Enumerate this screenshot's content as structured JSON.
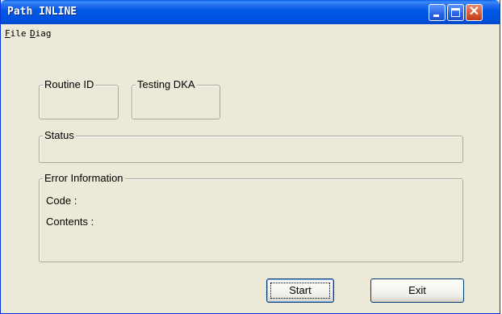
{
  "window": {
    "title": "Path INLINE",
    "controls": {
      "minimize": "minimize",
      "maximize": "maximize",
      "close": "close"
    }
  },
  "menu": {
    "items": [
      {
        "label_first": "F",
        "label_rest": "ile"
      },
      {
        "label_first": "D",
        "label_rest": "iag"
      }
    ]
  },
  "groups": {
    "routine_id": "Routine ID",
    "testing_dka": "Testing DKA",
    "status": "Status",
    "error_info": "Error Information"
  },
  "error": {
    "code_label": "Code :",
    "contents_label": "Contents :"
  },
  "buttons": {
    "start": "Start",
    "exit": "Exit"
  },
  "colors": {
    "title_bar": "#0058e6",
    "window_bg": "#ece9d8",
    "close_button": "#d65933"
  }
}
